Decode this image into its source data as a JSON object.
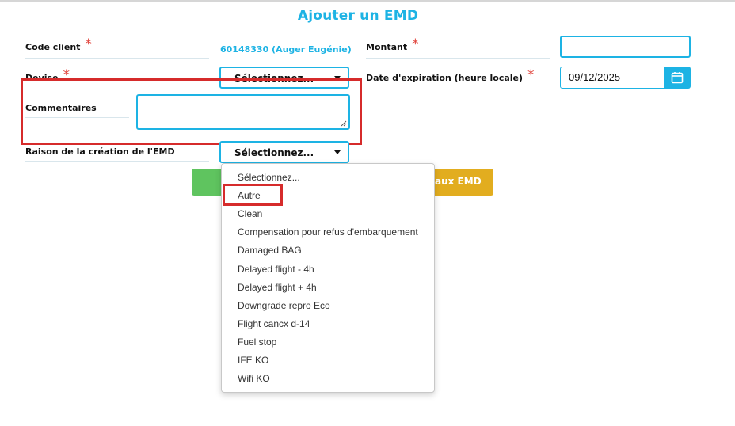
{
  "page": {
    "title": "Ajouter un EMD"
  },
  "form": {
    "code_client": {
      "label": "Code client",
      "required": "*",
      "value": "60148330 (Auger Eugénie)"
    },
    "montant": {
      "label": "Montant",
      "required": "*",
      "value": ""
    },
    "devise": {
      "label": "Devise",
      "required": "*",
      "selected": "Sélectionnez..."
    },
    "date_expiration": {
      "label": "Date d'expiration (heure locale)",
      "required": "*",
      "value": "09/12/2025"
    },
    "commentaires": {
      "label": "Commentaires",
      "value": ""
    },
    "raison": {
      "label": "Raison de la création de l'EMD",
      "selected": "Sélectionnez..."
    }
  },
  "buttons": {
    "retour_label": "aux EMD"
  },
  "dropdown": {
    "options": [
      "Sélectionnez...",
      "Autre",
      "Clean",
      "Compensation pour refus d'embarquement",
      "Damaged BAG",
      "Delayed flight - 4h",
      "Delayed flight + 4h",
      "Downgrade repro Eco",
      "Flight cancx d-14",
      "Fuel stop",
      "IFE KO",
      "Wifi KO"
    ],
    "highlighted": "Autre"
  },
  "colors": {
    "accent": "#1db3e4",
    "required": "#e0423a",
    "highlight_box": "#d62b2b",
    "green_button": "#5fc45f",
    "yellow_button": "#e2ad1f"
  },
  "icons": {
    "date_picker": "calendar-icon",
    "select": "chevron-down-icon",
    "textarea": "resize-handle-icon"
  }
}
